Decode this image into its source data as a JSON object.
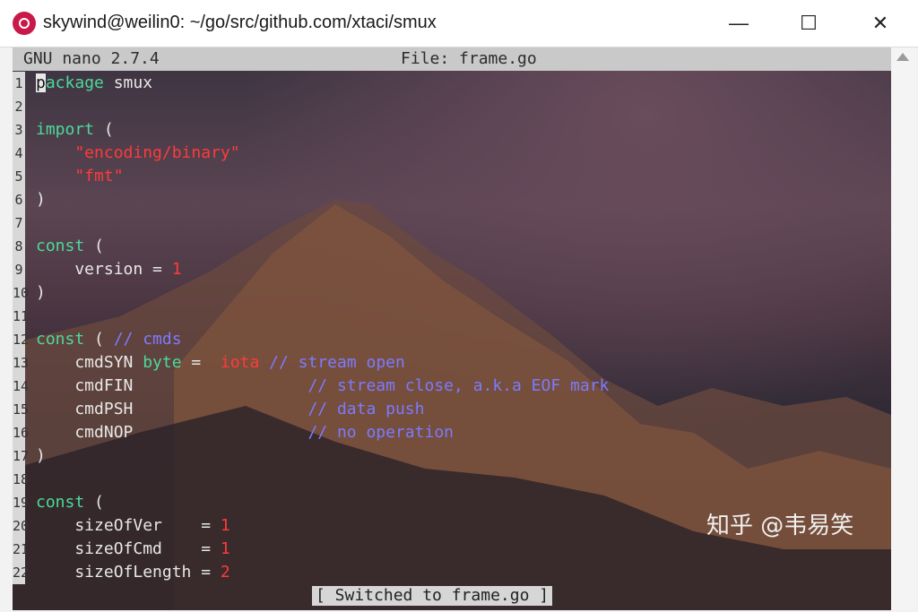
{
  "window": {
    "title": "skywind@weilin0: ~/go/src/github.com/xtaci/smux",
    "minimize_glyph": "—",
    "maximize_glyph": "☐",
    "close_glyph": "✕"
  },
  "nano": {
    "version": "GNU nano 2.7.4",
    "file": "File: frame.go",
    "status_message": "[ Switched to frame.go ]"
  },
  "editor": {
    "lines": [
      {
        "n": "1",
        "parts": [
          {
            "t": "p",
            "c": "cursor"
          },
          {
            "t": "ackage",
            "c": "kw"
          },
          {
            "t": " smux",
            "c": "plain"
          }
        ]
      },
      {
        "n": "2",
        "parts": []
      },
      {
        "n": "3",
        "parts": [
          {
            "t": "import",
            "c": "kw"
          },
          {
            "t": " (",
            "c": "plain"
          }
        ]
      },
      {
        "n": "4",
        "parts": [
          {
            "t": "    \"encoding/binary\"",
            "c": "str"
          }
        ]
      },
      {
        "n": "5",
        "parts": [
          {
            "t": "    \"fmt\"",
            "c": "str"
          }
        ]
      },
      {
        "n": "6",
        "parts": [
          {
            "t": ")",
            "c": "plain"
          }
        ]
      },
      {
        "n": "7",
        "parts": []
      },
      {
        "n": "8",
        "parts": [
          {
            "t": "const",
            "c": "kw"
          },
          {
            "t": " (",
            "c": "plain"
          }
        ]
      },
      {
        "n": "9",
        "parts": [
          {
            "t": "    version = ",
            "c": "plain"
          },
          {
            "t": "1",
            "c": "num"
          }
        ]
      },
      {
        "n": "10",
        "parts": [
          {
            "t": ")",
            "c": "plain"
          }
        ]
      },
      {
        "n": "11",
        "parts": []
      },
      {
        "n": "12",
        "parts": [
          {
            "t": "const",
            "c": "kw"
          },
          {
            "t": " ( ",
            "c": "plain"
          },
          {
            "t": "// cmds",
            "c": "comment"
          }
        ]
      },
      {
        "n": "13",
        "parts": [
          {
            "t": "    cmdSYN ",
            "c": "plain"
          },
          {
            "t": "byte",
            "c": "kw"
          },
          {
            "t": " = ",
            "c": "plain"
          },
          {
            "t": " iota",
            "c": "num"
          },
          {
            "t": " // stream open",
            "c": "comment"
          }
        ]
      },
      {
        "n": "14",
        "parts": [
          {
            "t": "    cmdFIN                  ",
            "c": "plain"
          },
          {
            "t": "// stream close, a.k.a EOF mark",
            "c": "comment"
          }
        ]
      },
      {
        "n": "15",
        "parts": [
          {
            "t": "    cmdPSH                  ",
            "c": "plain"
          },
          {
            "t": "// data push",
            "c": "comment"
          }
        ]
      },
      {
        "n": "16",
        "parts": [
          {
            "t": "    cmdNOP                  ",
            "c": "plain"
          },
          {
            "t": "// no operation",
            "c": "comment"
          }
        ]
      },
      {
        "n": "17",
        "parts": [
          {
            "t": ")",
            "c": "plain"
          }
        ]
      },
      {
        "n": "18",
        "parts": []
      },
      {
        "n": "19",
        "parts": [
          {
            "t": "const",
            "c": "kw"
          },
          {
            "t": " (",
            "c": "plain"
          }
        ]
      },
      {
        "n": "20",
        "parts": [
          {
            "t": "    sizeOfVer    = ",
            "c": "plain"
          },
          {
            "t": "1",
            "c": "num"
          }
        ]
      },
      {
        "n": "21",
        "parts": [
          {
            "t": "    sizeOfCmd    = ",
            "c": "plain"
          },
          {
            "t": "1",
            "c": "num"
          }
        ]
      },
      {
        "n": "22",
        "parts": [
          {
            "t": "    sizeOfLength = ",
            "c": "plain"
          },
          {
            "t": "2",
            "c": "num"
          }
        ]
      }
    ]
  },
  "watermark": "知乎 @韦易笑",
  "colors": {
    "keyword": "#4dd99a",
    "string": "#ff3b3b",
    "comment": "#7b7bff",
    "title_icon": "#c9184a"
  }
}
